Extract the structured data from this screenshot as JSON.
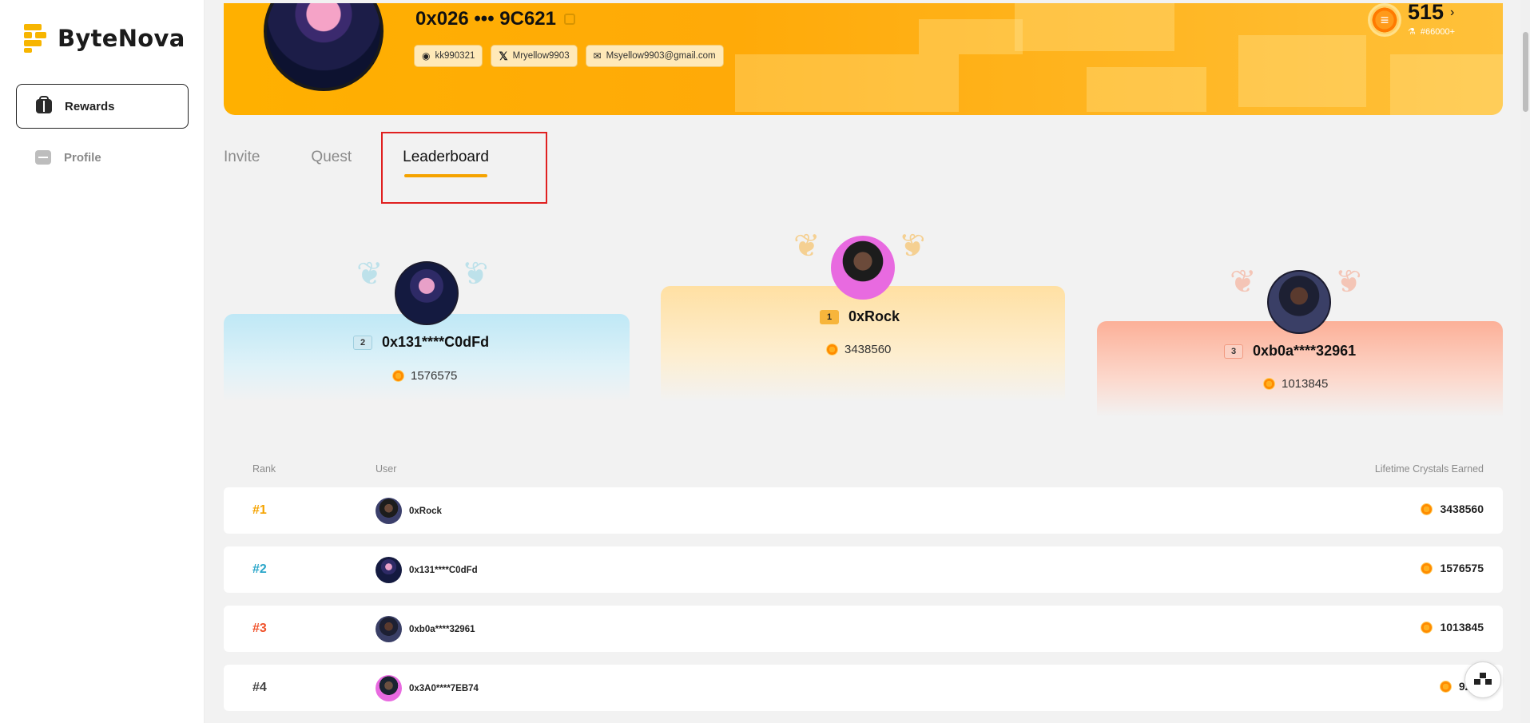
{
  "sidebar": {
    "brand": "ByteNova",
    "items": [
      {
        "label": "Rewards",
        "icon": "gift-icon",
        "active": true
      },
      {
        "label": "Profile",
        "icon": "profile-card-icon",
        "active": false
      }
    ]
  },
  "profile": {
    "wallet": "0x026 ••• 9C621",
    "discord": "kk990321",
    "twitter": "Mryellow9903",
    "email": "Msyellow9903@gmail.com",
    "points": "515",
    "rank": "#66000+"
  },
  "tabs": [
    "Invite",
    "Quest",
    "Leaderboard"
  ],
  "active_tab": "Leaderboard",
  "podium": [
    {
      "rank": "2",
      "name": "0x131****C0dFd",
      "score": "1576575",
      "color": "#8fd3ea"
    },
    {
      "rank": "1",
      "name": "0xRock",
      "score": "3438560",
      "color": "#f7b53b"
    },
    {
      "rank": "3",
      "name": "0xb0a****32961",
      "score": "1013845",
      "color": "#f4876a"
    }
  ],
  "table": {
    "headers": {
      "rank": "Rank",
      "user": "User",
      "earned": "Lifetime Crystals Earned"
    },
    "rows": [
      {
        "rank": "#1",
        "user": "0xRock",
        "score": "3438560",
        "color": "#f5a300"
      },
      {
        "rank": "#2",
        "user": "0x131****C0dFd",
        "score": "1576575",
        "color": "#2aa6c9"
      },
      {
        "rank": "#3",
        "user": "0xb0a****32961",
        "score": "1013845",
        "color": "#f0512a"
      },
      {
        "rank": "#4",
        "user": "0x3A0****7EB74",
        "score": "9218",
        "color": "#444444"
      }
    ]
  }
}
